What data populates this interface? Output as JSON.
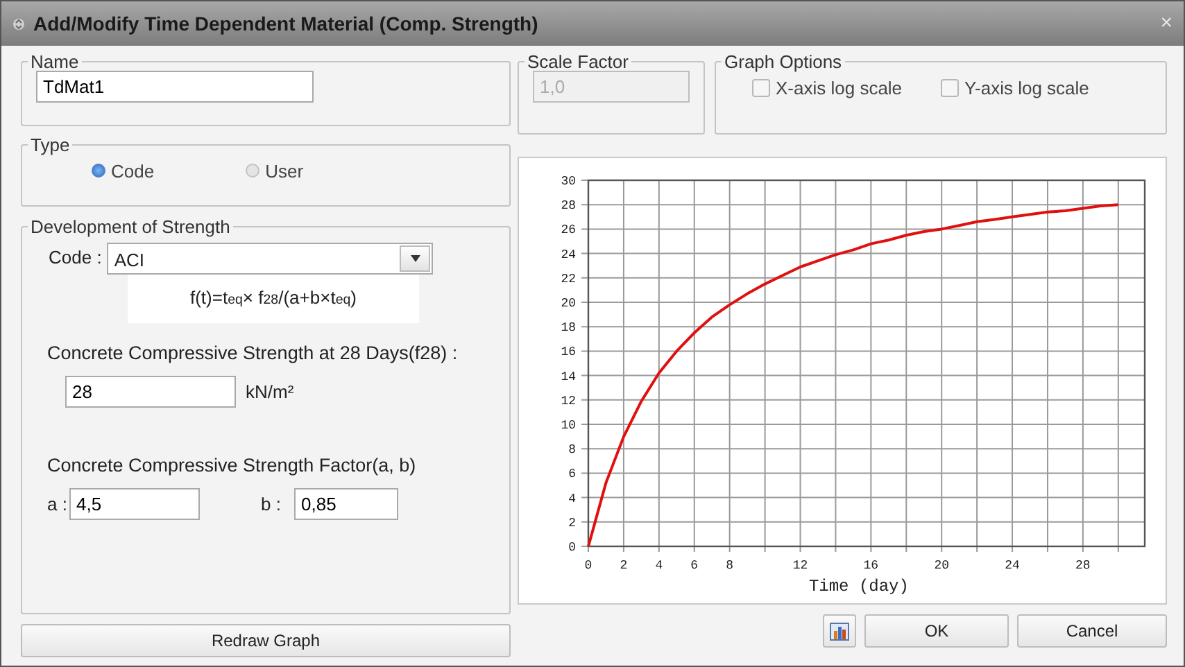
{
  "window": {
    "title": "Add/Modify Time Dependent Material (Comp. Strength)",
    "close": "×"
  },
  "name_group": {
    "label": "Name",
    "value": "TdMat1"
  },
  "scale_factor": {
    "label": "Scale Factor",
    "value": "1,0",
    "disabled": true
  },
  "graph_options": {
    "label": "Graph Options",
    "options": [
      {
        "label": "X-axis log scale",
        "checked": false
      },
      {
        "label": "Y-axis log scale",
        "checked": false
      }
    ]
  },
  "type": {
    "label": "Type",
    "options": [
      {
        "label": "Code",
        "selected": true
      },
      {
        "label": "User",
        "selected": false
      }
    ]
  },
  "development": {
    "label": "Development of Strength",
    "code_label": "Code :",
    "code": {
      "value": "ACI"
    },
    "formula": "f(t)=t$_{eq}$× f$_{28}$/(a+b×t$_{eq}$)",
    "f28_label": "Concrete Compressive Strength at 28 Days(f28) :",
    "f28": {
      "value": "28"
    },
    "f28_unit": "kN/m²",
    "factor_label": "Concrete Compressive Strength Factor(a, b)",
    "a_label": "a :",
    "a": {
      "value": "4,5"
    },
    "b_label": "b :",
    "b": {
      "value": "0,85"
    }
  },
  "chart": {
    "chart_data": {
      "type": "line",
      "xlabel": "Time (day)",
      "xlim": [
        0,
        31.5
      ],
      "ylim": [
        0,
        30
      ],
      "grid": true,
      "x": [
        0,
        1,
        2,
        3,
        4,
        5,
        6,
        7,
        8,
        9,
        10,
        11,
        12,
        13,
        14,
        15,
        16,
        17,
        18,
        19,
        20,
        21,
        22,
        23,
        24,
        25,
        26,
        27,
        28,
        29,
        30
      ],
      "series": [
        {
          "color": "#e01010",
          "values": [
            0,
            5.2,
            9.0,
            11.9,
            14.2,
            16.0,
            17.5,
            18.8,
            19.8,
            20.7,
            21.5,
            22.2,
            22.9,
            23.4,
            23.9,
            24.3,
            24.8,
            25.1,
            25.5,
            25.8,
            26.0,
            26.3,
            26.6,
            26.8,
            27.0,
            27.2,
            27.4,
            27.5,
            27.7,
            27.9,
            28.0
          ]
        }
      ],
      "xticks": [
        0,
        2,
        4,
        6,
        8,
        12,
        16,
        20,
        24,
        28
      ],
      "yticks": [
        0,
        2,
        4,
        6,
        8,
        10,
        12,
        14,
        16,
        18,
        20,
        22,
        24,
        26,
        28,
        30
      ]
    }
  },
  "buttons": {
    "redraw": "Redraw Graph",
    "ok": "OK",
    "cancel": "Cancel"
  }
}
